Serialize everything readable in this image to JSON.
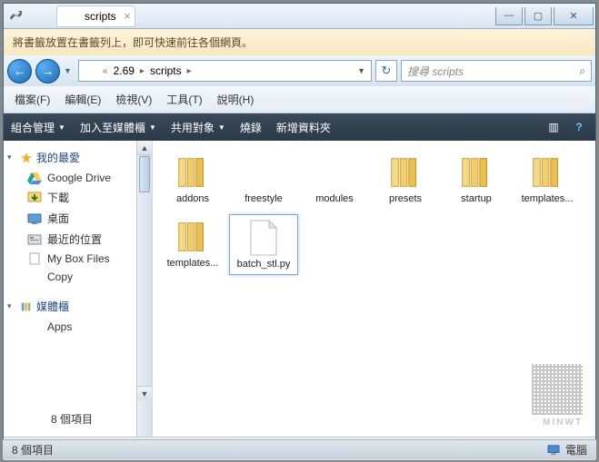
{
  "window": {
    "tab_title": "scripts",
    "min": "—",
    "max": "▢",
    "close": "✕"
  },
  "info_bar": "將書籤放置在書籤列上，即可快速前往各個網頁。",
  "nav": {
    "back": "←",
    "forward": "→",
    "path_parts": [
      "2.69",
      "scripts"
    ],
    "refresh": "↻"
  },
  "search": {
    "placeholder": "搜尋 scripts",
    "icon": "⌕"
  },
  "menu": {
    "file": "檔案(F)",
    "edit": "編輯(E)",
    "view": "檢視(V)",
    "tools": "工具(T)",
    "help": "說明(H)"
  },
  "toolbar": {
    "organize": "組合管理",
    "include": "加入至媒體櫃",
    "share": "共用對象",
    "burn": "燒錄",
    "new_folder": "新增資料夾",
    "view_icon": "▥",
    "help_icon": "?"
  },
  "sidebar": {
    "fav_label": "我的最愛",
    "items": [
      {
        "label": "Google Drive",
        "icon": "drive"
      },
      {
        "label": "下載",
        "icon": "download"
      },
      {
        "label": "桌面",
        "icon": "desktop"
      },
      {
        "label": "最近的位置",
        "icon": "recent"
      },
      {
        "label": "My Box Files",
        "icon": "file"
      },
      {
        "label": "Copy",
        "icon": "folder"
      }
    ],
    "lib_label": "媒體櫃",
    "lib_items": [
      {
        "label": "Apps",
        "icon": "folder"
      }
    ],
    "preview_count": "8 個項目"
  },
  "files": [
    {
      "name": "addons",
      "type": "folder-multi"
    },
    {
      "name": "freestyle",
      "type": "folder"
    },
    {
      "name": "modules",
      "type": "folder"
    },
    {
      "name": "presets",
      "type": "folder-multi"
    },
    {
      "name": "startup",
      "type": "folder-multi"
    },
    {
      "name": "templates...",
      "type": "folder-multi"
    },
    {
      "name": "templates...",
      "type": "folder-multi"
    },
    {
      "name": "batch_stl.py",
      "type": "file",
      "selected": true
    }
  ],
  "status": {
    "items": "8 個項目",
    "computer": "電腦"
  },
  "watermark": "MINWT"
}
